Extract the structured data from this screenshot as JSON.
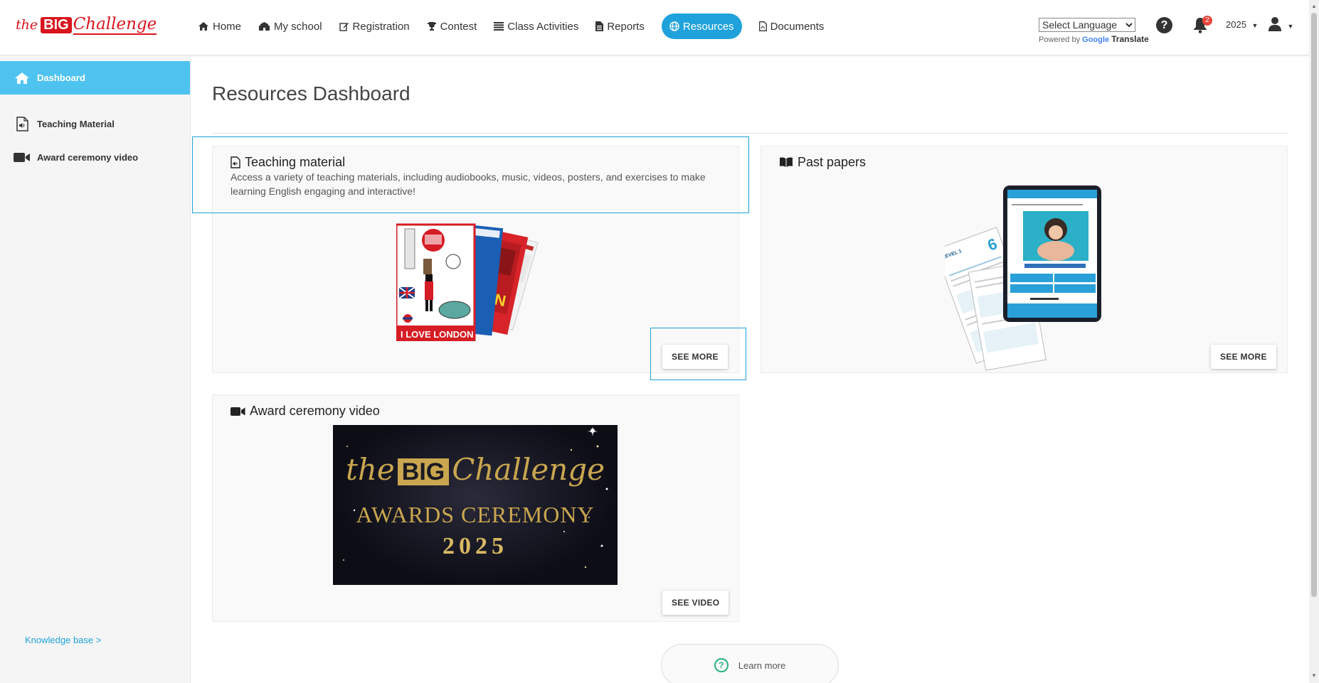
{
  "brand": {
    "logo_the": "the",
    "logo_big": "BIG",
    "logo_challenge": "Challenge"
  },
  "nav": {
    "items": [
      {
        "label": "Home",
        "icon": "home-icon"
      },
      {
        "label": "My school",
        "icon": "school-icon"
      },
      {
        "label": "Registration",
        "icon": "edit-icon"
      },
      {
        "label": "Contest",
        "icon": "trophy-icon"
      },
      {
        "label": "Class Activities",
        "icon": "list-icon"
      },
      {
        "label": "Reports",
        "icon": "file-icon"
      },
      {
        "label": "Resources",
        "icon": "globe-icon",
        "active": true
      },
      {
        "label": "Documents",
        "icon": "pdf-icon"
      }
    ]
  },
  "language": {
    "selected": "Select Language",
    "powered_by": "Powered by",
    "google": "Google",
    "translate": "Translate"
  },
  "notifications": {
    "count": "2"
  },
  "year": "2025",
  "sidebar": {
    "items": [
      {
        "label": "Dashboard",
        "icon": "home-icon",
        "active": true
      },
      {
        "label": "Teaching Material",
        "icon": "audio-file-icon"
      },
      {
        "label": "Award ceremony video",
        "icon": "video-camera-icon"
      }
    ],
    "knowledge_base": "Knowledge base >"
  },
  "main": {
    "title": "Resources Dashboard",
    "cards": {
      "teaching": {
        "title": "Teaching material",
        "description": "Access a variety of teaching materials, including audiobooks, music, videos, posters, and exercises to make learning English engaging and interactive!",
        "button": "SEE MORE"
      },
      "past_papers": {
        "title": "Past papers",
        "button": "SEE MORE"
      },
      "award": {
        "title": "Award ceremony video",
        "button": "SEE VIDEO",
        "thumb_the": "the",
        "thumb_big": "BIG",
        "thumb_challenge": "Challenge",
        "thumb_sub": "AWARDS CEREMONY",
        "thumb_year": "2025"
      }
    },
    "learn_more": "Learn more"
  },
  "colors": {
    "accent": "#1fa2dc",
    "sidebar_active": "#4ec3ef",
    "brand_red": "#d9141d"
  }
}
